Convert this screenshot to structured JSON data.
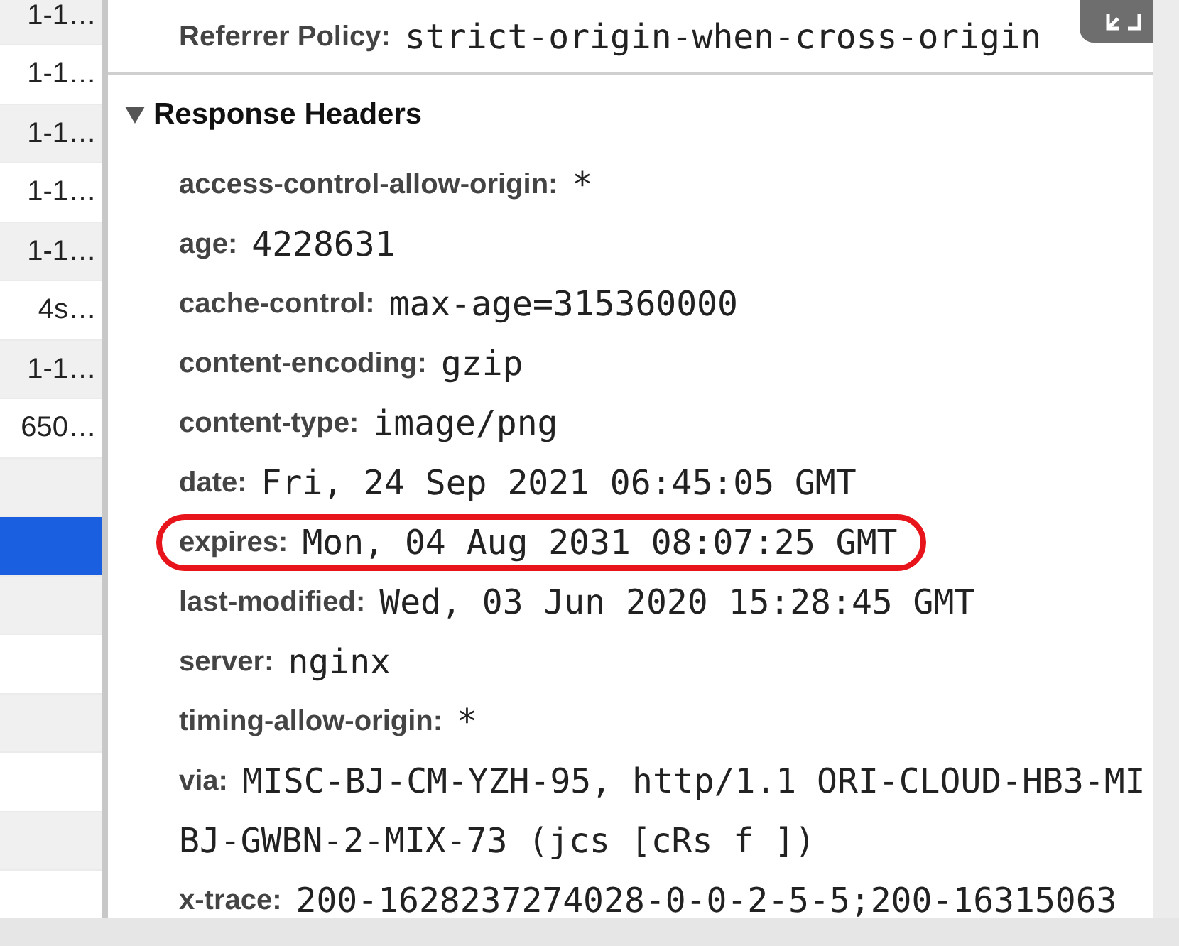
{
  "request_list": [
    {
      "label": "1-1…",
      "selected": false
    },
    {
      "label": "1-1…",
      "selected": false
    },
    {
      "label": "1-1…",
      "selected": false
    },
    {
      "label": "1-1…",
      "selected": false
    },
    {
      "label": "1-1…",
      "selected": false
    },
    {
      "label": "4s…",
      "selected": false
    },
    {
      "label": "1-1…",
      "selected": false
    },
    {
      "label": "650…",
      "selected": false
    },
    {
      "selected": false
    },
    {
      "selected": true
    },
    {
      "selected": false
    },
    {
      "selected": false
    },
    {
      "selected": false
    },
    {
      "selected": false
    },
    {
      "selected": false
    }
  ],
  "general": {
    "key": "Referrer Policy:",
    "value": "strict-origin-when-cross-origin"
  },
  "response_headers": {
    "title": "Response Headers",
    "expanded": true,
    "items": [
      {
        "key": "access-control-allow-origin:",
        "value": [
          "*"
        ],
        "highlighted": false
      },
      {
        "key": "age:",
        "value": [
          "4228631"
        ],
        "highlighted": false
      },
      {
        "key": "cache-control:",
        "value": [
          "max-age=315360000"
        ],
        "highlighted": false
      },
      {
        "key": "content-encoding:",
        "value": [
          "gzip"
        ],
        "highlighted": false
      },
      {
        "key": "content-type:",
        "value": [
          "image/png"
        ],
        "highlighted": false
      },
      {
        "key": "date:",
        "value": [
          "Fri, 24 Sep 2021 06:45:05 GMT"
        ],
        "highlighted": false
      },
      {
        "key": "expires:",
        "value": [
          "Mon, 04 Aug 2031 08:07:25 GMT"
        ],
        "highlighted": true
      },
      {
        "key": "last-modified:",
        "value": [
          "Wed, 03 Jun 2020 15:28:45 GMT"
        ],
        "highlighted": false
      },
      {
        "key": "server:",
        "value": [
          "nginx"
        ],
        "highlighted": false
      },
      {
        "key": "timing-allow-origin:",
        "value": [
          "*"
        ],
        "highlighted": false
      },
      {
        "key": "via:",
        "value": [
          "MISC-BJ-CM-YZH-95, http/1.1 ORI-CLOUD-HB3-MI",
          "BJ-GWBN-2-MIX-73 (jcs [cRs f ])"
        ],
        "highlighted": false
      },
      {
        "key": "x-trace:",
        "value": [
          "200-1628237274028-0-0-2-5-5;200-16315063"
        ],
        "highlighted": false
      }
    ]
  }
}
